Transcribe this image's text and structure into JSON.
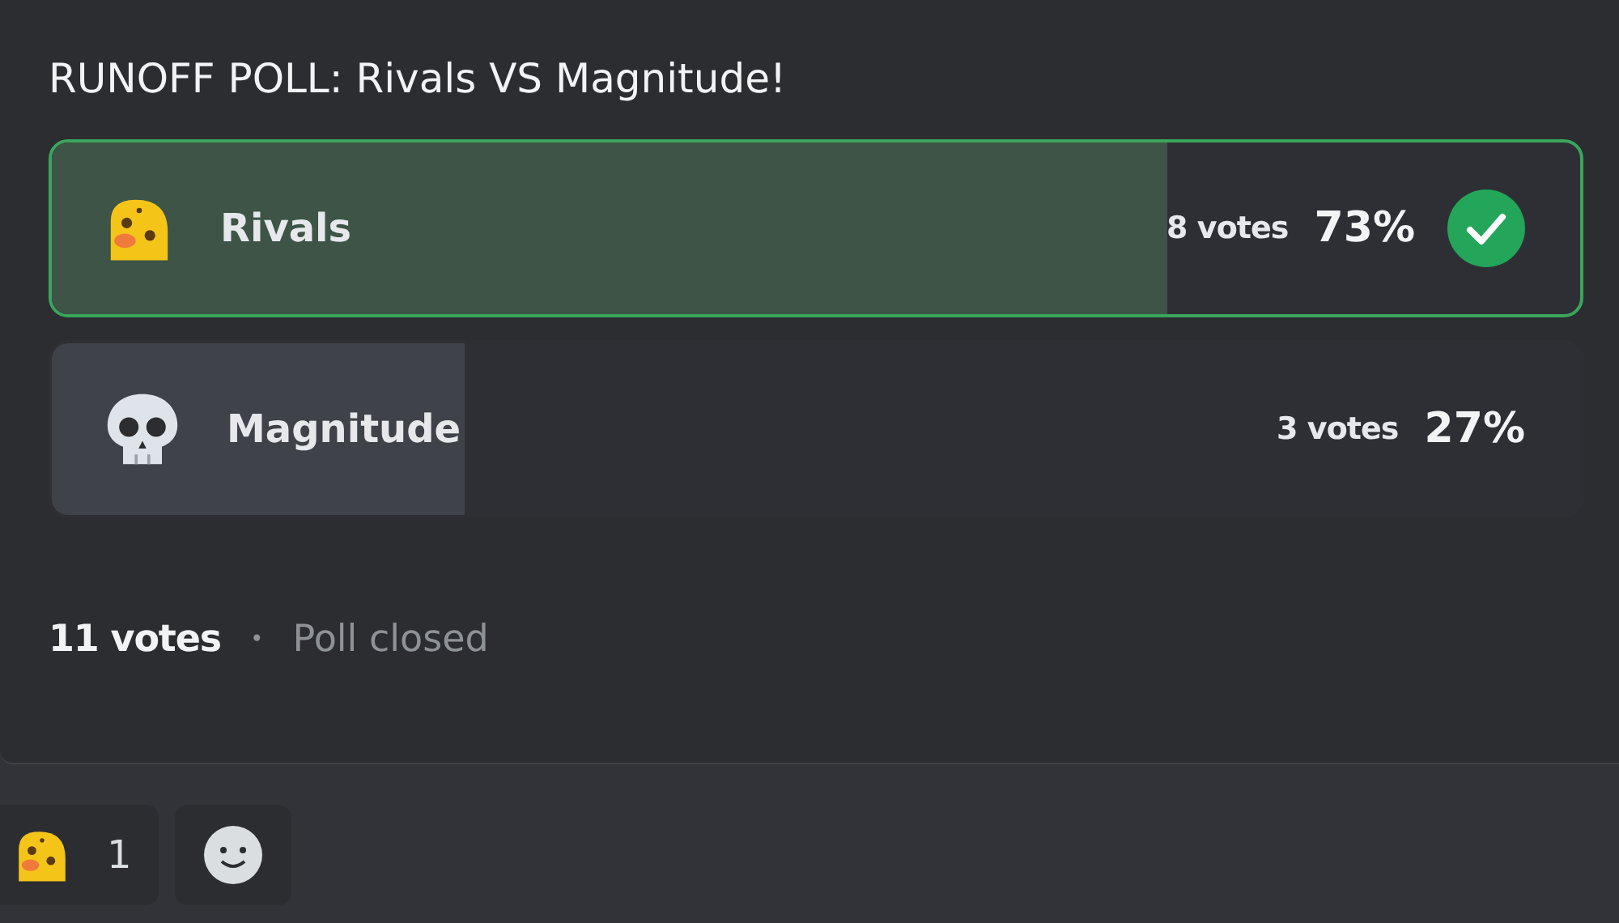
{
  "poll": {
    "question": "RUNOFF POLL: Rivals VS Magnitude!",
    "answers": [
      {
        "label": "Rivals",
        "votes": "8 votes",
        "percent": "73%",
        "level": 0.73,
        "selected": true
      },
      {
        "label": "Magnitude",
        "votes": "3 votes",
        "percent": "27%",
        "level": 0.27,
        "selected": false
      }
    ],
    "total": "11 votes",
    "separator": "•",
    "status": "Poll closed"
  },
  "reactions": [
    {
      "count": "1"
    }
  ]
}
